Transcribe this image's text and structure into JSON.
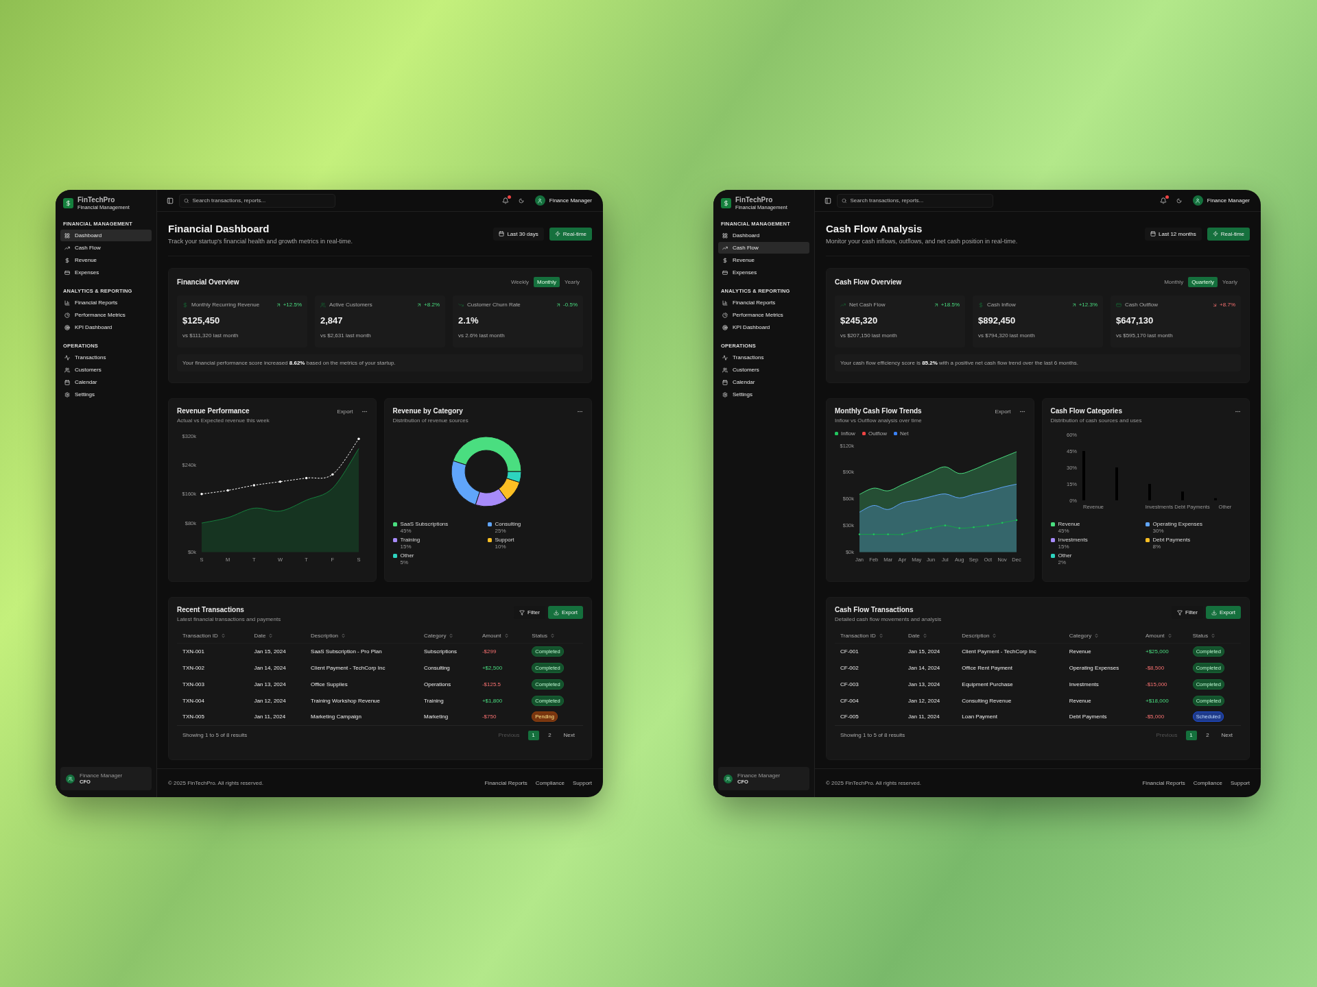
{
  "screens": [
    {
      "brand": {
        "name": "FinTechPro",
        "tagline": "Financial Management"
      },
      "sidebar": {
        "sections": [
          {
            "heading": "FINANCIAL MANAGEMENT",
            "items": [
              {
                "label": "Dashboard",
                "selected": true
              },
              {
                "label": "Cash Flow",
                "selected": false
              },
              {
                "label": "Revenue",
                "selected": false
              },
              {
                "label": "Expenses",
                "selected": false
              }
            ]
          },
          {
            "heading": "ANALYTICS & REPORTING",
            "items": [
              {
                "label": "Financial Reports",
                "selected": false
              },
              {
                "label": "Performance Metrics",
                "selected": false
              },
              {
                "label": "KPI Dashboard",
                "selected": false
              }
            ]
          },
          {
            "heading": "OPERATIONS",
            "items": [
              {
                "label": "Transactions",
                "selected": false
              },
              {
                "label": "Customers",
                "selected": false
              },
              {
                "label": "Calendar",
                "selected": false
              },
              {
                "label": "Settings",
                "selected": false
              }
            ]
          }
        ],
        "user": {
          "name": "Finance Manager",
          "role": "CFO"
        }
      },
      "topbar": {
        "search_placeholder": "Search transactions, reports...",
        "user_name": "Finance Manager"
      },
      "header": {
        "title": "Financial Dashboard",
        "subtitle": "Track your startup's financial health and growth metrics in real-time.",
        "date_range": "Last 30 days",
        "live_button": "Real-time"
      },
      "overview": {
        "title": "Financial Overview",
        "periods": [
          {
            "label": "Weekly",
            "selected": false
          },
          {
            "label": "Monthly",
            "selected": true
          },
          {
            "label": "Yearly",
            "selected": false
          }
        ],
        "metrics": [
          {
            "kind": "revenue",
            "label": "Monthly Recurring Revenue",
            "change": "+12.5%",
            "rising": true,
            "value": "$125,450",
            "comparison": "vs $111,320 last month"
          },
          {
            "kind": "customers",
            "label": "Active Customers",
            "change": "+8.2%",
            "rising": true,
            "value": "2,847",
            "comparison": "vs $2,631 last month"
          },
          {
            "kind": "churn",
            "label": "Customer Churn Rate",
            "change": "-0.5%",
            "rising": true,
            "value": "2.1%",
            "comparison": "vs 2.6% last month"
          }
        ],
        "summary": "Your financial performance score increased **8.62%** based on the metrics of your startup."
      },
      "trend_card": {
        "title": "Revenue Performance",
        "subtitle": "Actual vs Expected revenue this week",
        "export": "Export",
        "chart_data": {
          "type": "area",
          "categories": [
            "S",
            "M",
            "T",
            "W",
            "T",
            "F",
            "S"
          ],
          "ylim": [
            0,
            320
          ],
          "yticks": [
            {
              "value": 0,
              "label": "$0k"
            },
            {
              "value": 80,
              "label": "$80k"
            },
            {
              "value": 160,
              "label": "$160k"
            },
            {
              "value": 240,
              "label": "$240k"
            },
            {
              "value": 320,
              "label": "$320k"
            }
          ],
          "series": [
            {
              "type": "area",
              "color": "#15803d",
              "values": [
                80,
                95,
                121,
                113,
                143,
                176,
                285
              ]
            },
            {
              "type": "line",
              "line_style": "dashed",
              "color": "#ffffff",
              "values": [
                160,
                170,
                184,
                194,
                204,
                214,
                312
              ]
            }
          ]
        }
      },
      "category_card": {
        "title": "Revenue by Category",
        "subtitle": "Distribution of revenue sources",
        "chart_data": {
          "type": "donut",
          "categories": [
            "SaaS Subscriptions",
            "Consulting",
            "Training",
            "Support",
            "Other"
          ],
          "values": [
            45,
            25,
            15,
            10,
            5
          ],
          "colors": [
            "#4ade80",
            "#60a5fa",
            "#a78bfa",
            "#fbbf24",
            "#2dd4bf"
          ]
        },
        "legend": [
          {
            "share": "45%",
            "color": "#4ade80"
          },
          {
            "share": "25%",
            "color": "#60a5fa"
          },
          {
            "share": "15%",
            "color": "#a78bfa"
          },
          {
            "share": "10%",
            "color": "#fbbf24"
          },
          {
            "share": "5%",
            "color": "#2dd4bf"
          }
        ]
      },
      "transactions": {
        "title": "Recent Transactions",
        "subtitle": "Latest financial transactions and payments",
        "filter": "Filter",
        "export": "Export",
        "columns": [
          "Transaction ID",
          "Date",
          "Description",
          "Category",
          "Amount",
          "Status"
        ],
        "rows": [
          {
            "id": "TXN-001",
            "date": "Jan 15, 2024",
            "description": "SaaS Subscription - Pro Plan",
            "category": "Subscriptions",
            "amount": "-$299",
            "incoming": false,
            "status": {
              "label": "Completed",
              "kind": "completed"
            }
          },
          {
            "id": "TXN-002",
            "date": "Jan 14, 2024",
            "description": "Client Payment - TechCorp Inc",
            "category": "Consulting",
            "amount": "+$2,500",
            "incoming": true,
            "status": {
              "label": "Completed",
              "kind": "completed"
            }
          },
          {
            "id": "TXN-003",
            "date": "Jan 13, 2024",
            "description": "Office Supplies",
            "category": "Operations",
            "amount": "-$125.5",
            "incoming": false,
            "status": {
              "label": "Completed",
              "kind": "completed"
            }
          },
          {
            "id": "TXN-004",
            "date": "Jan 12, 2024",
            "description": "Training Workshop Revenue",
            "category": "Training",
            "amount": "+$1,800",
            "incoming": true,
            "status": {
              "label": "Completed",
              "kind": "completed"
            }
          },
          {
            "id": "TXN-005",
            "date": "Jan 11, 2024",
            "description": "Marketing Campaign",
            "category": "Marketing",
            "amount": "-$750",
            "incoming": false,
            "status": {
              "label": "Pending",
              "kind": "pending"
            }
          }
        ],
        "summary": "Showing 1 to 5 of 8 results",
        "previous": {
          "label": "Previous",
          "disabled": true
        },
        "pages": [
          {
            "label": "1",
            "selected": true
          },
          {
            "label": "2",
            "selected": false
          }
        ],
        "next": {
          "label": "Next",
          "disabled": false
        }
      },
      "footer": {
        "copyright": "© 2025 FinTechPro. All rights reserved.",
        "links": [
          "Financial Reports",
          "Compliance",
          "Support"
        ]
      }
    },
    {
      "brand": {
        "name": "FinTechPro",
        "tagline": "Financial Management"
      },
      "sidebar": {
        "sections": [
          {
            "heading": "FINANCIAL MANAGEMENT",
            "items": [
              {
                "label": "Dashboard",
                "selected": false
              },
              {
                "label": "Cash Flow",
                "selected": true
              },
              {
                "label": "Revenue",
                "selected": false
              },
              {
                "label": "Expenses",
                "selected": false
              }
            ]
          },
          {
            "heading": "ANALYTICS & REPORTING",
            "items": [
              {
                "label": "Financial Reports",
                "selected": false
              },
              {
                "label": "Performance Metrics",
                "selected": false
              },
              {
                "label": "KPI Dashboard",
                "selected": false
              }
            ]
          },
          {
            "heading": "OPERATIONS",
            "items": [
              {
                "label": "Transactions",
                "selected": false
              },
              {
                "label": "Customers",
                "selected": false
              },
              {
                "label": "Calendar",
                "selected": false
              },
              {
                "label": "Settings",
                "selected": false
              }
            ]
          }
        ],
        "user": {
          "name": "Finance Manager",
          "role": "CFO"
        }
      },
      "topbar": {
        "search_placeholder": "Search transactions, reports...",
        "user_name": "Finance Manager"
      },
      "header": {
        "title": "Cash Flow Analysis",
        "subtitle": "Monitor your cash inflows, outflows, and net cash position in real-time.",
        "date_range": "Last 12 months",
        "live_button": "Real-time"
      },
      "overview": {
        "title": "Cash Flow Overview",
        "periods": [
          {
            "label": "Monthly",
            "selected": false
          },
          {
            "label": "Quarterly",
            "selected": true
          },
          {
            "label": "Yearly",
            "selected": false
          }
        ],
        "metrics": [
          {
            "kind": "net",
            "label": "Net Cash Flow",
            "change": "+18.5%",
            "rising": true,
            "value": "$245,320",
            "comparison": "vs $207,150 last month"
          },
          {
            "kind": "inflow",
            "label": "Cash Inflow",
            "change": "+12.3%",
            "rising": true,
            "value": "$892,450",
            "comparison": "vs $794,320 last month"
          },
          {
            "kind": "outflow",
            "label": "Cash Outflow",
            "change": "+8.7%",
            "rising": false,
            "value": "$647,130",
            "comparison": "vs $595,170 last month"
          }
        ],
        "summary": "Your cash flow efficiency score is **85.2%** with a positive net cash flow trend over the last 6 months."
      },
      "trend_card": {
        "title": "Monthly Cash Flow Trends",
        "subtitle": "Inflow vs Outflow analysis over time",
        "export": "Export",
        "legend": [
          {
            "label": "Inflow",
            "color": "#22c55e"
          },
          {
            "label": "Outflow",
            "color": "#ef4444"
          },
          {
            "label": "Net",
            "color": "#3b82f6"
          }
        ],
        "chart_data": {
          "type": "area",
          "stacked": false,
          "categories": [
            "Jan",
            "Feb",
            "Mar",
            "Apr",
            "May",
            "Jun",
            "Jul",
            "Aug",
            "Sep",
            "Oct",
            "Nov",
            "Dec"
          ],
          "ylim": [
            0,
            120
          ],
          "yticks": [
            {
              "value": 0,
              "label": "$0k"
            },
            {
              "value": 30,
              "label": "$30k"
            },
            {
              "value": 60,
              "label": "$60k"
            },
            {
              "value": 90,
              "label": "$90k"
            },
            {
              "value": 120,
              "label": "$120k"
            }
          ],
          "series": [
            {
              "type": "area",
              "color": "#4ade80",
              "values": [
                65,
                72,
                69,
                76,
                83,
                90,
                96,
                88.5,
                93,
                100,
                106.5,
                113
              ]
            },
            {
              "type": "area",
              "color": "#60a5fa",
              "values": [
                45,
                52.5,
                48,
                55.5,
                58.5,
                62.5,
                65.5,
                61,
                65,
                68.5,
                73,
                76.5
              ]
            },
            {
              "type": "line",
              "color": "#16a34a",
              "values": [
                20,
                20,
                20,
                20,
                24,
                27,
                30,
                27,
                28,
                30,
                33,
                36
              ]
            }
          ]
        }
      },
      "category_card": {
        "title": "Cash Flow Categories",
        "subtitle": "Distribution of cash sources and uses",
        "chart_data": {
          "type": "bar",
          "categories": [
            "Revenue",
            null,
            "Investments",
            "Debt Payments",
            "Other"
          ],
          "ylim": [
            0,
            60
          ],
          "yticks": [
            {
              "value": 0,
              "label": "0%"
            },
            {
              "value": 15,
              "label": "15%"
            },
            {
              "value": 30,
              "label": "30%"
            },
            {
              "value": 45,
              "label": "45%"
            },
            {
              "value": 60,
              "label": "60%"
            }
          ],
          "series": [
            {
              "color": "#000000",
              "values": [
                45,
                30,
                15,
                8,
                2
              ]
            }
          ]
        },
        "legend": [
          {
            "label": "Revenue",
            "share": "45%",
            "color": "#4ade80"
          },
          {
            "label": "Operating Expenses",
            "share": "30%",
            "color": "#60a5fa"
          },
          {
            "label": "Investments",
            "share": "15%",
            "color": "#a78bfa"
          },
          {
            "label": "Debt Payments",
            "share": "8%",
            "color": "#fbbf24"
          },
          {
            "label": "Other",
            "share": "2%",
            "color": "#2dd4bf"
          }
        ]
      },
      "transactions": {
        "title": "Cash Flow Transactions",
        "subtitle": "Detailed cash flow movements and analysis",
        "filter": "Filter",
        "export": "Export",
        "columns": [
          "Transaction ID",
          "Date",
          "Description",
          "Category",
          "Amount",
          "Status"
        ],
        "rows": [
          {
            "id": "CF-001",
            "date": "Jan 15, 2024",
            "description": "Client Payment - TechCorp Inc",
            "category": "Revenue",
            "amount": "+$25,000",
            "incoming": true,
            "status": {
              "label": "Completed",
              "kind": "completed"
            }
          },
          {
            "id": "CF-002",
            "date": "Jan 14, 2024",
            "description": "Office Rent Payment",
            "category": "Operating Expenses",
            "amount": "-$8,500",
            "incoming": false,
            "status": {
              "label": "Completed",
              "kind": "completed"
            }
          },
          {
            "id": "CF-003",
            "date": "Jan 13, 2024",
            "description": "Equipment Purchase",
            "category": "Investments",
            "amount": "-$15,000",
            "incoming": false,
            "status": {
              "label": "Completed",
              "kind": "completed"
            }
          },
          {
            "id": "CF-004",
            "date": "Jan 12, 2024",
            "description": "Consulting Revenue",
            "category": "Revenue",
            "amount": "+$18,000",
            "incoming": true,
            "status": {
              "label": "Completed",
              "kind": "completed"
            }
          },
          {
            "id": "CF-005",
            "date": "Jan 11, 2024",
            "description": "Loan Payment",
            "category": "Debt Payments",
            "amount": "-$5,000",
            "incoming": false,
            "status": {
              "label": "Scheduled",
              "kind": "scheduled"
            }
          }
        ],
        "summary": "Showing 1 to 5 of 8 results",
        "previous": {
          "label": "Previous",
          "disabled": true
        },
        "pages": [
          {
            "label": "1",
            "selected": true
          },
          {
            "label": "2",
            "selected": false
          }
        ],
        "next": {
          "label": "Next",
          "disabled": false
        }
      },
      "footer": {
        "copyright": "© 2025 FinTechPro. All rights reserved.",
        "links": [
          "Financial Reports",
          "Compliance",
          "Support"
        ]
      }
    }
  ]
}
